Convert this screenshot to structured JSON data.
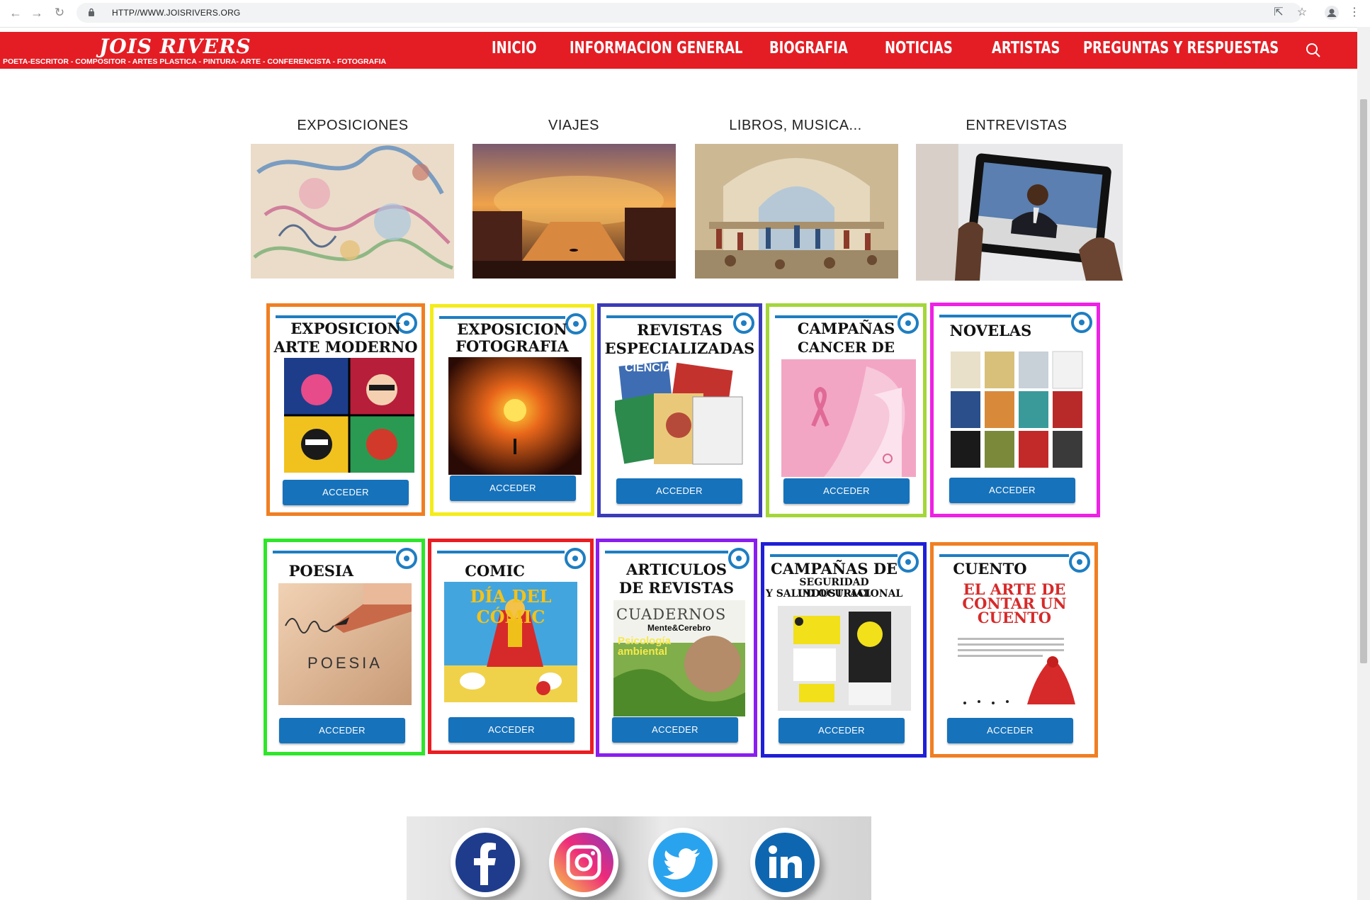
{
  "browser": {
    "url": "HTTP//WWW.JOISRIVERS.ORG"
  },
  "site": {
    "brand": "JOIS RIVERS",
    "tagline": "POETA-ESCRITOR - COMPOSITOR - ARTES PLASTICA - PINTURA- ARTE - CONFERENCISTA - FOTOGRAFIA",
    "menu": [
      "INICIO",
      "INFORMACION GENERAL",
      "BIOGRAFIA",
      "NOTICIAS",
      "ARTISTAS",
      "PREGUNTAS Y RESPUESTAS"
    ],
    "accent": "#e41d24"
  },
  "categories": [
    {
      "title": "EXPOSICIONES"
    },
    {
      "title": "VIAJES"
    },
    {
      "title": "LIBROS, MUSICA..."
    },
    {
      "title": "ENTREVISTAS"
    }
  ],
  "cards_row1": [
    {
      "title1": "EXPOSICION",
      "title2": "ARTE MODERNO",
      "button": "ACCEDER",
      "border": "#f07f22"
    },
    {
      "title1": "EXPOSICION",
      "title2": "FOTOGRAFIA",
      "button": "ACCEDER",
      "border": "#f4ec1a"
    },
    {
      "title1": "REVISTAS",
      "title2": "ESPECIALIZADAS",
      "button": "ACCEDER",
      "border": "#3b3bb8",
      "img_text": "CIENCIA"
    },
    {
      "title1": "CAMPAÑAS",
      "title2": "CANCER DE MAMA",
      "button": "ACCEDER",
      "border": "#a4d63a"
    },
    {
      "title1": "NOVELAS",
      "button": "ACCEDER",
      "border": "#ee21e4"
    }
  ],
  "cards_row2": [
    {
      "title1": "POESIA",
      "button": "ACCEDER",
      "border": "#2ee62a",
      "img_text": "POESIA"
    },
    {
      "title1": "COMIC",
      "button": "ACCEDER",
      "border": "#ea1d22",
      "img_text": "DÍA DEL CÓMIC"
    },
    {
      "title1": "ARTICULOS",
      "title2": "DE REVISTAS",
      "button": "ACCEDER",
      "border": "#8a1ef0",
      "img_text1": "CUADERNOS",
      "img_text2": "Mente&Cerebro",
      "img_text3": "Psicología ambiental"
    },
    {
      "title1": "CAMPAÑAS DE",
      "title2": "SEGURIDAD INDUSTRIAL",
      "title3": "Y SALUD OCUPACIONAL",
      "button": "ACCEDER",
      "border": "#1f1fd6"
    },
    {
      "title1": "CUENTO",
      "button": "ACCEDER",
      "border": "#f07f22",
      "img_text": "EL ARTE DE CONTAR UN CUENTO"
    }
  ],
  "social": [
    "facebook-icon",
    "instagram-icon",
    "twitter-icon",
    "linkedin-icon"
  ]
}
